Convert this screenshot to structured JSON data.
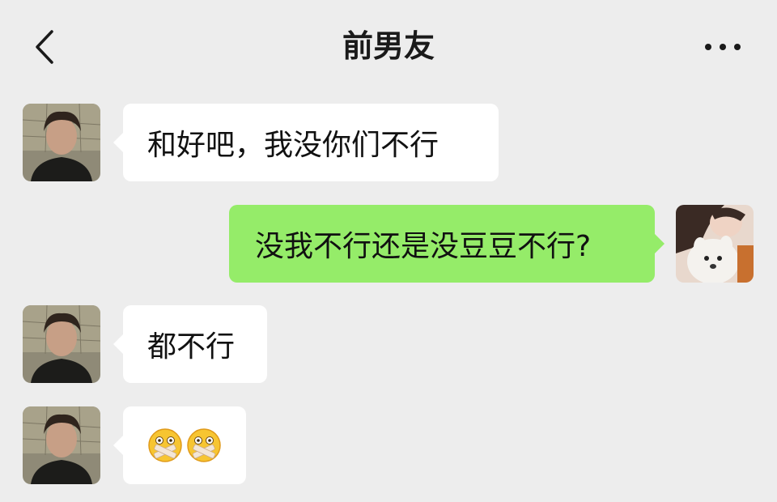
{
  "header": {
    "title": "前男友",
    "back_icon": "chevron-left-icon",
    "more_icon": "more-dots-icon"
  },
  "colors": {
    "background": "#ededed",
    "incoming_bubble": "#ffffff",
    "outgoing_bubble": "#95ec69"
  },
  "messages": [
    {
      "sender": "contact",
      "text": "和好吧，我没你们不行"
    },
    {
      "sender": "me",
      "text": "没我不行还是没豆豆不行?"
    },
    {
      "sender": "contact",
      "text": "都不行"
    },
    {
      "sender": "contact",
      "emojis": [
        "shush-face-emoji",
        "shush-face-emoji"
      ]
    }
  ]
}
